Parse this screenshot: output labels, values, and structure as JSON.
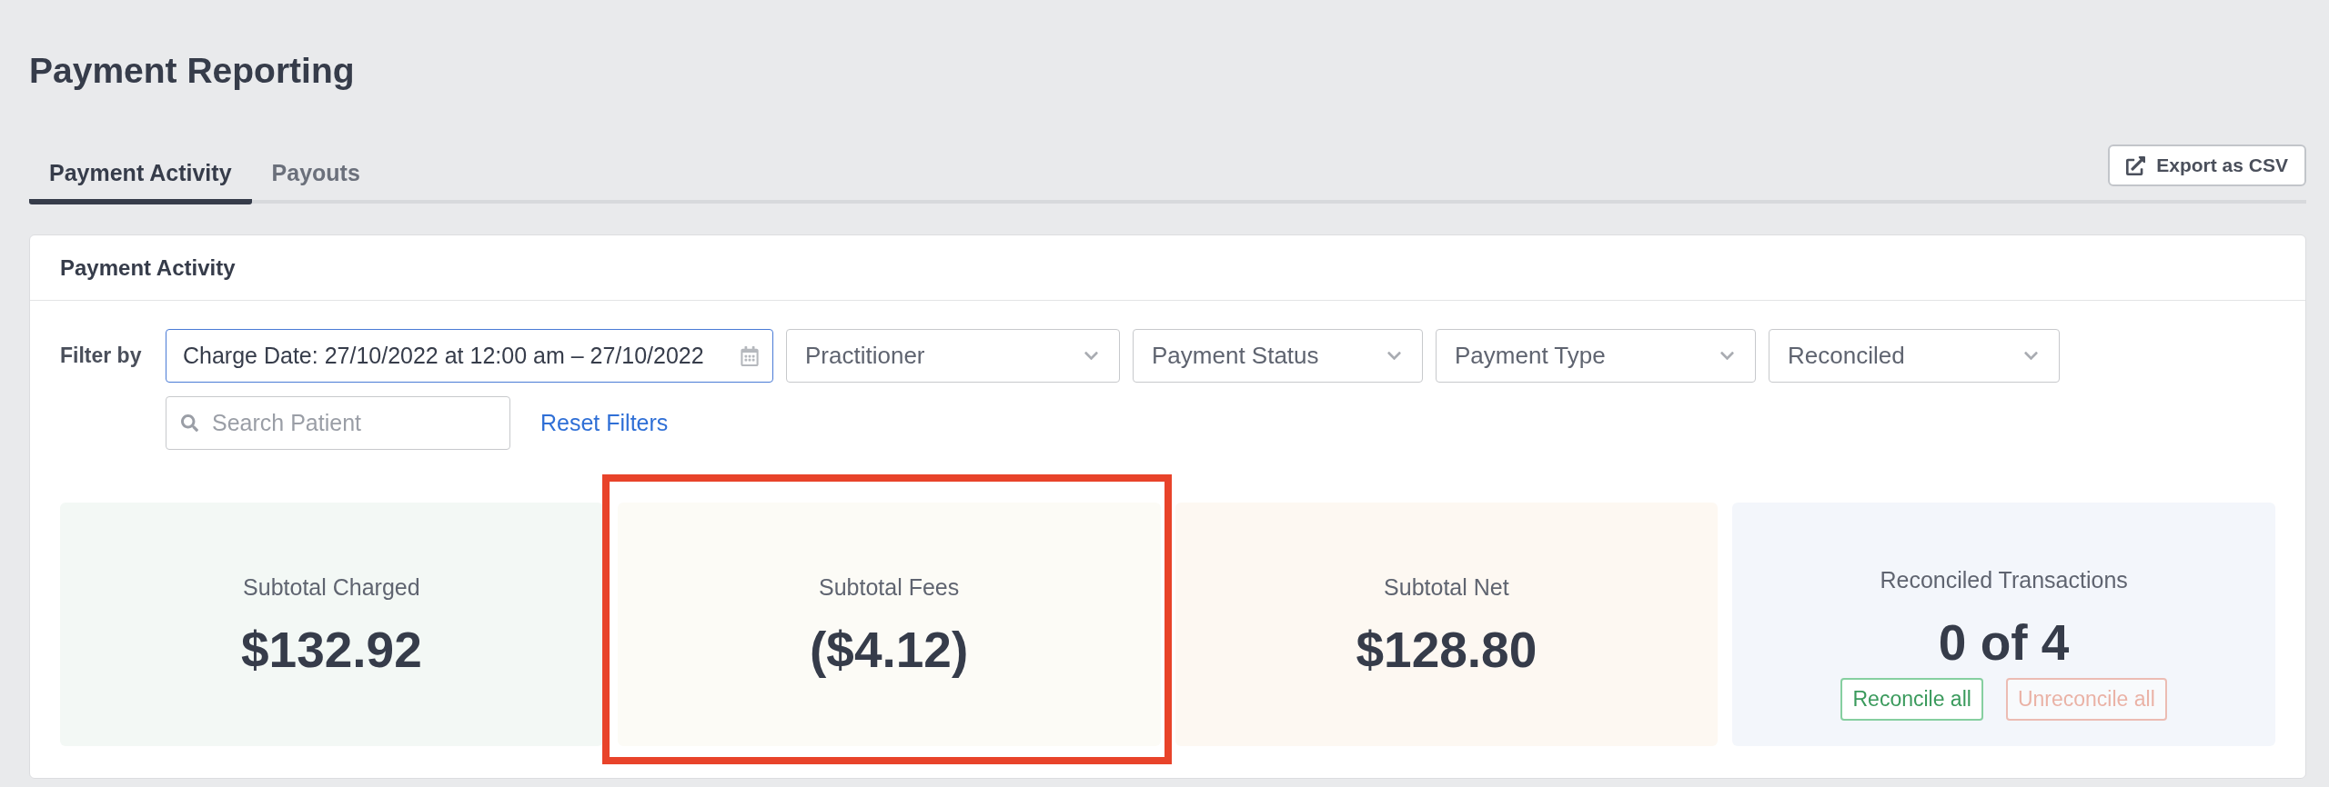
{
  "page": {
    "title": "Payment Reporting"
  },
  "tabs": [
    {
      "label": "Payment Activity",
      "selected": true
    },
    {
      "label": "Payouts",
      "selected": false
    }
  ],
  "export_button": {
    "label": "Export as CSV"
  },
  "panel": {
    "title": "Payment Activity"
  },
  "filters": {
    "label": "Filter by",
    "date_range": {
      "value": "Charge Date: 27/10/2022 at 12:00 am – 27/10/2022",
      "focused": true
    },
    "dropdowns": [
      {
        "placeholder": "Practitioner"
      },
      {
        "placeholder": "Payment Status"
      },
      {
        "placeholder": "Payment Type"
      },
      {
        "placeholder": "Reconciled"
      }
    ],
    "search": {
      "placeholder": "Search Patient"
    },
    "reset_link": "Reset Filters"
  },
  "summary_cards": [
    {
      "label": "Subtotal Charged",
      "value": "$132.92",
      "color": "#f3f8f5",
      "highlighted": false
    },
    {
      "label": "Subtotal Fees",
      "value": "($4.12)",
      "color": "#fcfbf6",
      "highlighted": true
    },
    {
      "label": "Subtotal Net",
      "value": "$128.80",
      "color": "#fdf8f2",
      "highlighted": false
    },
    {
      "label": "Reconciled Transactions",
      "value": "0 of 4",
      "color": "#f3f6fb",
      "highlighted": false,
      "actions": [
        {
          "label": "Reconcile all",
          "kind": "positive",
          "disabled": false
        },
        {
          "label": "Unreconcile all",
          "kind": "negative",
          "disabled": true
        }
      ]
    }
  ]
}
